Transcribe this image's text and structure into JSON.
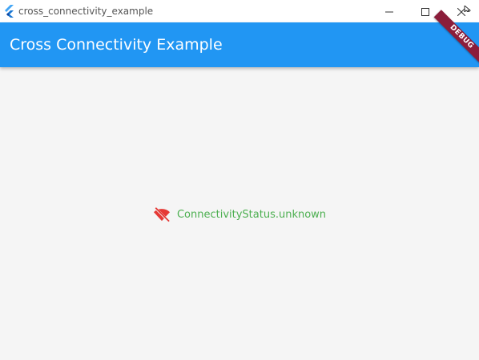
{
  "window": {
    "title": "cross_connectivity_example",
    "logo_icon": "flutter-logo-icon",
    "controls": {
      "minimize_icon": "minimize-icon",
      "maximize_icon": "maximize-icon",
      "close_icon": "close-icon"
    }
  },
  "appbar": {
    "title": "Cross Connectivity Example",
    "color": "#2196f3"
  },
  "debug_banner": {
    "label": "DEBUG",
    "color": "#8b1d3a"
  },
  "status": {
    "icon": "wifi-off-icon",
    "icon_color": "#e53935",
    "text": "ConnectivityStatus.unknown",
    "text_color": "#4caf50"
  }
}
